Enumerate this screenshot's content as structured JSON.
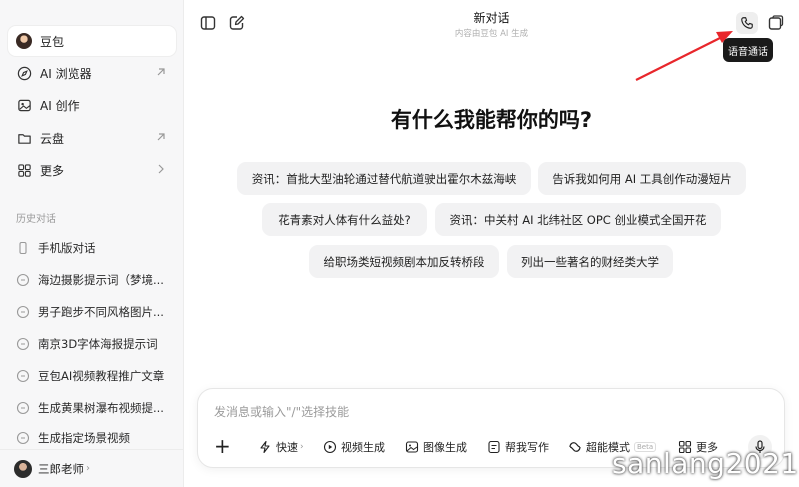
{
  "sidebar": {
    "items": [
      {
        "label": "豆包",
        "icon": "avatar-icon"
      },
      {
        "label": "AI 浏览器",
        "icon": "compass-icon"
      },
      {
        "label": "AI 创作",
        "icon": "image-icon"
      },
      {
        "label": "云盘",
        "icon": "folder-icon"
      },
      {
        "label": "更多",
        "icon": "grid-icon"
      }
    ],
    "history_title": "历史对话",
    "history": [
      "手机版对话",
      "海边摄影提示词（梦境...",
      "男子跑步不同风格图片...",
      "南京3D字体海报提示词",
      "豆包AI视频教程推广文章",
      "生成黄果树瀑布视频提...",
      "生成指定场景视频"
    ],
    "user": "三郎老师"
  },
  "header": {
    "title": "新对话",
    "subtitle": "内容由豆包 AI 生成",
    "tooltip": "语音通话"
  },
  "main": {
    "headline": "有什么我能帮你的吗?",
    "suggestions": [
      "资讯：首批大型油轮通过替代航道驶出霍尔木兹海峡",
      "告诉我如何用 AI 工具创作动漫短片",
      "花青素对人体有什么益处?",
      "资讯：中关村 AI 北纬社区 OPC 创业模式全国开花",
      "给职场类短视频剧本加反转桥段",
      "列出一些著名的财经类大学"
    ]
  },
  "input": {
    "placeholder": "发消息或输入\"/\"选择技能",
    "plus": "+",
    "tools": [
      "快速",
      "视频生成",
      "图像生成",
      "帮我写作",
      "超能模式",
      "更多"
    ],
    "beta": "Beta"
  },
  "watermark": "sanlang2021",
  "colors": {
    "accent_red": "#e8262b",
    "tooltip_bg": "#1a1a1a"
  }
}
